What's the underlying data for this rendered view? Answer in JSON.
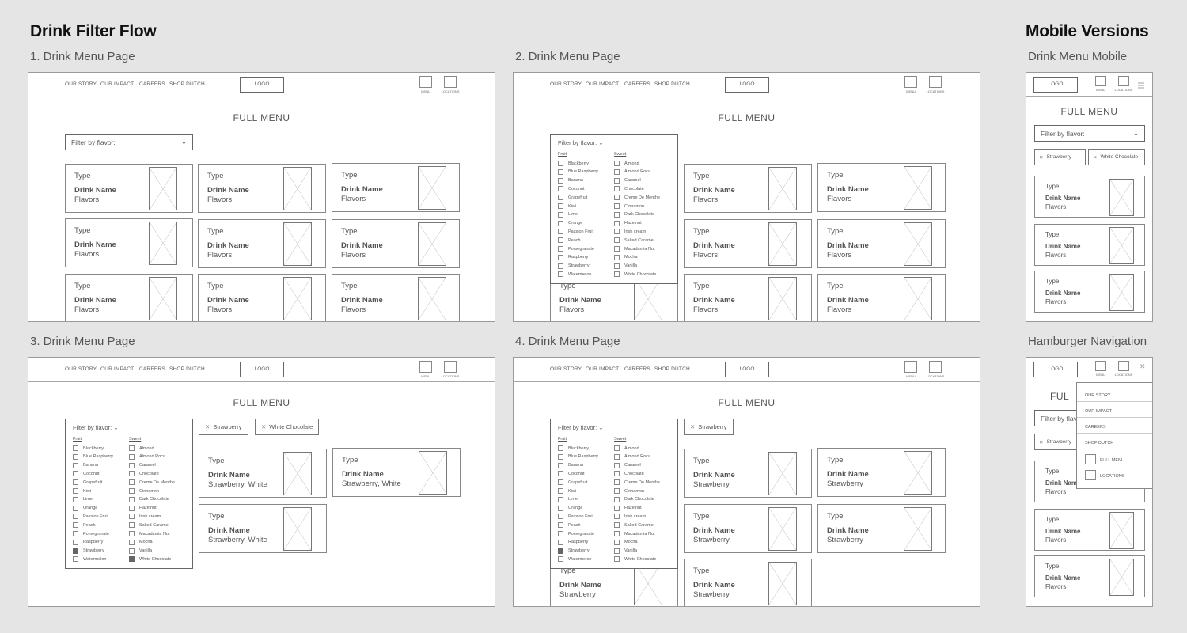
{
  "page": {
    "title": "Drink Filter Flow",
    "mobile_title": "Mobile Versions"
  },
  "labels": {
    "f1": "1. Drink Menu Page",
    "f2": "2. Drink Menu Page",
    "f3": "3. Drink Menu Page",
    "f4": "4. Drink Menu Page",
    "m1": "Drink Menu Mobile",
    "m2": "Hamburger Navigation"
  },
  "nav": {
    "links": [
      "OUR STORY",
      "OUR IMPACT",
      "CAREERS",
      "SHOP DUTCH"
    ],
    "logo": "LOGO",
    "menu": "MENU",
    "locations": "LOCATIONS",
    "hamburger_icon": "hamburger-icon",
    "close_icon": "close-icon"
  },
  "menu_heading": "FULL MENU",
  "filter": {
    "placeholder": "Filter by flavor:",
    "fruit_heading": "Fruit",
    "sweet_heading": "Sweet",
    "fruit": [
      "Blackberry",
      "Blue Raspberry",
      "Banana",
      "Coconut",
      "Grapefruit",
      "Kiwi",
      "Lime",
      "Orange",
      "Passion Fruit",
      "Peach",
      "Pomegranate",
      "Raspberry",
      "Strawberry",
      "Watermelon"
    ],
    "sweet": [
      "Almond",
      "Almond Roca",
      "Caramel",
      "Chocolate",
      "Creme De Menthe",
      "Cinnamon",
      "Dark Chocolate",
      "Hazelnut",
      "Irish cream",
      "Salted Caramel",
      "Macadamia Nut",
      "Mocha",
      "Vanilla",
      "White Chocolate"
    ]
  },
  "chips": {
    "strawberry": "Strawberry",
    "white_chocolate": "White Chocolate"
  },
  "card": {
    "type": "Type",
    "name": "Drink Name",
    "flavors": "Flavors",
    "flavors_both": "Strawberry, White",
    "flavors_strawberry": "Strawberry"
  },
  "hamburger_menu": {
    "items": [
      "OUR STORY",
      "OUR IMPACT",
      "CAREERS",
      "SHOP DUTCH"
    ],
    "full_menu": "FULL MENU",
    "locations": "LOCATIONS"
  },
  "clipped": {
    "full_menu": "FUL",
    "filter": "Filter by flav",
    "strawberry": "Strawberry",
    "drink_name": "Drink Nam"
  }
}
